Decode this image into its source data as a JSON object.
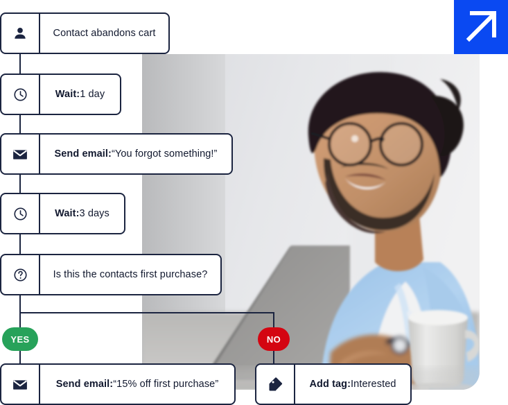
{
  "brand": {
    "logo_icon": "arrow-up-right-icon",
    "logo_bg_color": "#0a49f2",
    "logo_fg_color": "#ffffff"
  },
  "colors": {
    "node_border": "#1b2440",
    "node_text": "#11182e",
    "yes_badge": "#27a25a",
    "no_badge": "#d40511",
    "connector": "#1b2440"
  },
  "photo": {
    "alt": "Smiling man with glasses and beard in a light blue shirt working on a laptop with a coffee mug on the desk"
  },
  "workflow": {
    "nodes": [
      {
        "id": "trigger",
        "icon": "person-icon",
        "label_bold": "",
        "label_regular": "Contact abandons cart"
      },
      {
        "id": "wait-1",
        "icon": "clock-icon",
        "label_bold": "Wait:",
        "label_regular": " 1 day"
      },
      {
        "id": "email-1",
        "icon": "envelope-icon",
        "label_bold": "Send email:",
        "label_regular": " “You forgot something!”"
      },
      {
        "id": "wait-2",
        "icon": "clock-icon",
        "label_bold": "Wait:",
        "label_regular": " 3 days"
      },
      {
        "id": "condition",
        "icon": "question-mark-icon",
        "label_bold": "",
        "label_regular": "Is this the contacts first purchase?"
      },
      {
        "id": "email-2",
        "icon": "envelope-icon",
        "label_bold": "Send email:",
        "label_regular": " “15% off first purchase”"
      },
      {
        "id": "add-tag",
        "icon": "tag-icon",
        "label_bold": "Add tag:",
        "label_regular": " Interested"
      }
    ],
    "branches": [
      {
        "id": "yes",
        "label": "YES"
      },
      {
        "id": "no",
        "label": "NO"
      }
    ]
  }
}
